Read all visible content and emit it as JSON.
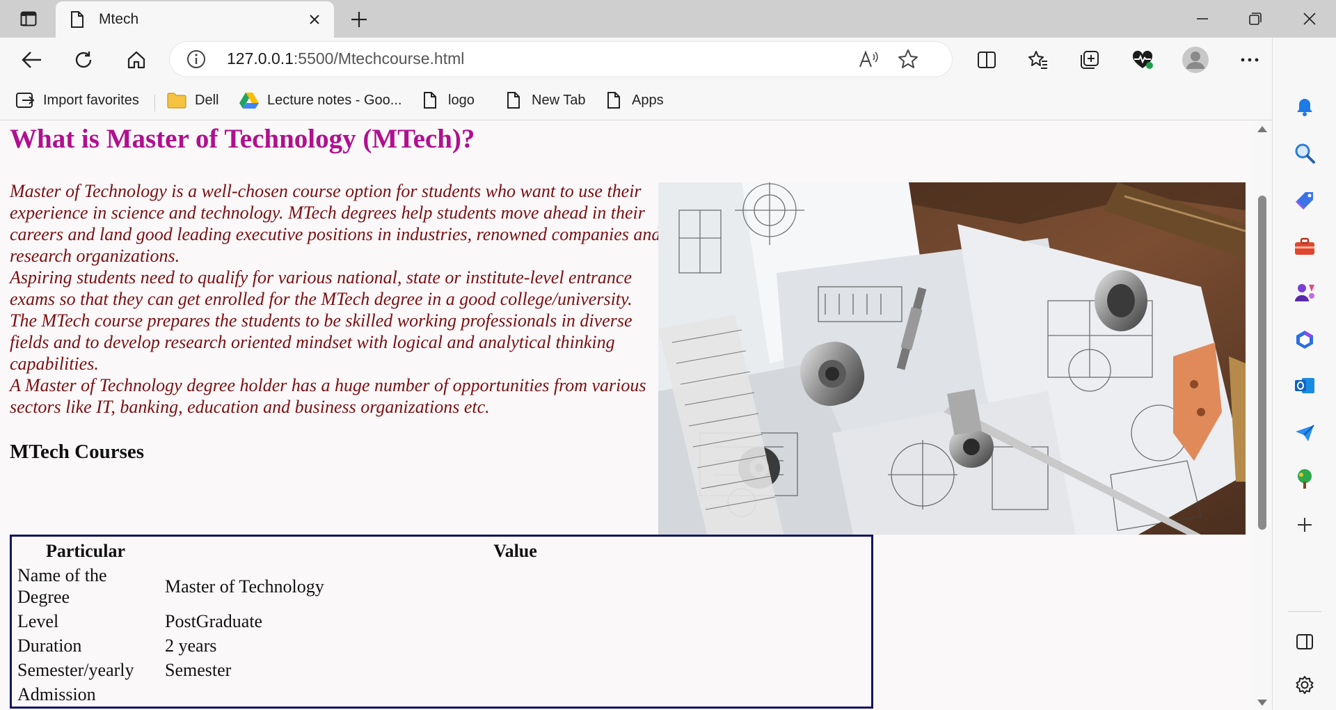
{
  "browser": {
    "tab_title": "Mtech",
    "url_host": "127.0.0.1",
    "url_path": ":5500/Mtechcourse.html",
    "favorites": [
      {
        "label": "Import favorites",
        "icon": "import-icon"
      },
      {
        "label": "Dell",
        "icon": "folder-icon"
      },
      {
        "label": "Lecture notes - Goo...",
        "icon": "google-drive-icon"
      },
      {
        "label": "logo",
        "icon": "page-icon"
      },
      {
        "label": "New Tab",
        "icon": "page-icon"
      },
      {
        "label": "Apps",
        "icon": "page-icon"
      }
    ],
    "sidebar_icons": [
      "bell-icon",
      "search-icon",
      "tag-icon",
      "toolbox-icon",
      "games-icon",
      "office-icon",
      "outlook-icon",
      "send-icon",
      "tree-icon",
      "plus-icon",
      "sidebar-icon",
      "settings-icon"
    ]
  },
  "page": {
    "title": "What is Master of Technology (MTech)?",
    "intro": [
      "Master of Technology is a well-chosen course option for students who want to use their experience in science and technology. MTech degrees help students move ahead in their careers and land good leading executive positions in industries, renowned companies and research organizations.",
      "Aspiring students need to qualify for various national, state or institute-level entrance exams so that they can get enrolled for the MTech degree in a good college/university. The MTech course prepares the students to be skilled working professionals in diverse fields and to develop research oriented mindset with logical and analytical thinking capabilities.",
      "A Master of Technology degree holder has a huge number of opportunities from various sectors like IT, banking, education and business organizations etc."
    ],
    "courses_heading": "MTech Courses",
    "table": {
      "headers": [
        "Particular",
        "Value"
      ],
      "rows": [
        [
          "Name of the Degree",
          "Master of Technology"
        ],
        [
          "Level",
          "PostGraduate"
        ],
        [
          "Duration",
          "2 years"
        ],
        [
          "Semester/yearly",
          "Semester"
        ],
        [
          "Admission",
          ""
        ]
      ]
    }
  }
}
